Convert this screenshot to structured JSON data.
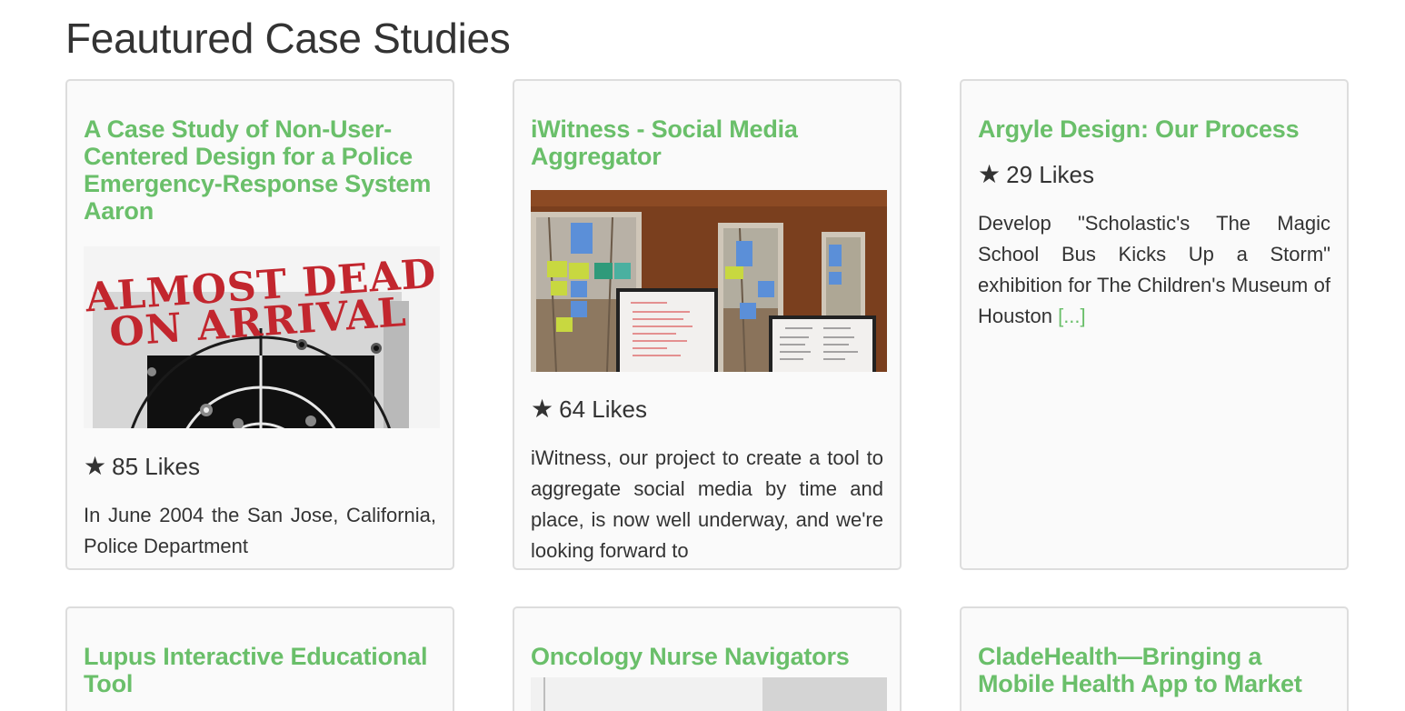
{
  "page": {
    "title": "Feautured Case Studies"
  },
  "colors": {
    "link_green": "#6abf6a",
    "card_bg": "#fafafa",
    "card_border": "#dddddd",
    "text": "#333333"
  },
  "cards": [
    {
      "title": "A Case Study of Non-User-Centered Design for a Police Emergency-Response System Aaron",
      "thumbnail_text_line1": "ALMOST DEAD",
      "thumbnail_text_line2": "ON ARRIVAL",
      "likes": "85 Likes",
      "excerpt": "In June 2004 the San Jose, California, Police Department",
      "more": ""
    },
    {
      "title": "iWitness - Social Media Aggregator",
      "likes": "64 Likes",
      "excerpt": "iWitness, our project to create a tool to aggregate social media by time and place, is now well underway, and we're looking forward to",
      "more": ""
    },
    {
      "title": "Argyle Design: Our Process",
      "likes": "29 Likes",
      "excerpt": "Develop \"Scholastic's The Magic School Bus Kicks Up a Storm\" exhibition for The Children's Museum of Houston",
      "more": "[...]"
    },
    {
      "title": "Lupus Interactive Educational Tool"
    },
    {
      "title": "Oncology Nurse Navigators"
    },
    {
      "title": "CladeHealth—Bringing a Mobile Health App to Market"
    }
  ]
}
